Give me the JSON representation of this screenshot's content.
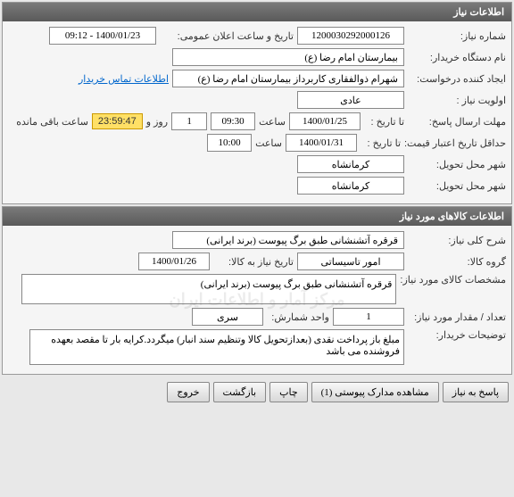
{
  "panel1": {
    "title": "اطلاعات نیاز",
    "need_number_label": "شماره نیاز:",
    "need_number": "1200030292000126",
    "public_announce_label": "تاریخ و ساعت اعلان عمومی:",
    "public_announce": "1400/01/23 - 09:12",
    "buyer_org_label": "نام دستگاه خریدار:",
    "buyer_org": "بیمارستان امام رضا (ع)",
    "requester_label": "ایجاد کننده درخواست:",
    "requester": "شهرام ذوالفقاری کاربرداز بیمارستان امام رضا (ع)",
    "contact_link": "اطلاعات تماس خریدار",
    "priority_label": "اولویت نیاز :",
    "priority": "عادی",
    "reply_deadline_label": "مهلت ارسال پاسخ:",
    "until_date_label": "تا تاریخ :",
    "until_date": "1400/01/25",
    "time_label": "ساعت",
    "until_time": "09:30",
    "days_count": "1",
    "days_label": "روز و",
    "remaining_time": "23:59:47",
    "remaining_label": "ساعت باقی مانده",
    "price_validity_label": "حداقل تاریخ اعتبار قیمت:",
    "price_until_date": "1400/01/31",
    "price_until_time": "10:00",
    "delivery_city_label": "شهر محل تحویل:",
    "delivery_city": "کرمانشاه",
    "delivery_city_label2": "شهر محل تحویل:",
    "delivery_city2": "کرمانشاه"
  },
  "panel2": {
    "title": "اطلاعات کالاهای مورد نیاز",
    "general_desc_label": "شرح کلی نیاز:",
    "general_desc": "قرقره آتشنشانی طبق برگ پیوست (برند ایرانی)",
    "goods_group_label": "گروه کالا:",
    "goods_group": "امور تاسیساتی",
    "need_date_label": "تاریخ نیاز به کالا:",
    "need_date": "1400/01/26",
    "spec_label": "مشخصات کالای مورد نیاز:",
    "spec": "قرقره آتشنشانی طبق برگ پیوست (برند ایرانی)",
    "qty_label": "تعداد / مقدار مورد نیاز:",
    "qty": "1",
    "unit_label": "واحد شمارش:",
    "unit": "سری",
    "buyer_notes_label": "توضیحات خریدار:",
    "buyer_notes": "مبلغ باز پرداخت نقدی (بعدازتحویل کالا وتنظیم سند انبار) میگردد.کرایه بار تا مقصد بعهده فروشنده می باشد",
    "watermark": "مرکز آمار و اطلاعات ایران"
  },
  "buttons": {
    "reply": "پاسخ به نیاز",
    "attachments": "مشاهده مدارک پیوستی (1)",
    "print": "چاپ",
    "back": "بازگشت",
    "exit": "خروج"
  }
}
